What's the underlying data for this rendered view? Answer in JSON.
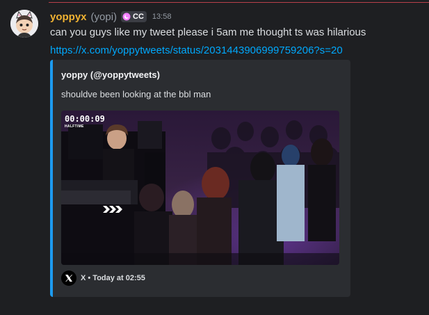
{
  "message": {
    "author": {
      "username": "yoppyx",
      "nickname": "(yopi)",
      "tag_label": "CC"
    },
    "timestamp": "13:58",
    "content": "can you guys like my tweet please i 5am me thought ts was hilarious",
    "link": "https://x.com/yoppytweets/status/2031443906999759206?s=20"
  },
  "embed": {
    "author": "yoppy (@yoppytweets)",
    "description": "shouldve been looking at the bbl man",
    "video": {
      "timer": "00:00:09",
      "sub_label": "HALFTIME"
    },
    "footer": {
      "icon": "x-logo-icon",
      "text": "X • Today at 02:55"
    }
  },
  "colors": {
    "background": "#1e1f22",
    "username": "#f0b232",
    "link": "#00a8fc",
    "embed_accent": "#1d9bf0",
    "embed_bg": "#2b2d31"
  }
}
